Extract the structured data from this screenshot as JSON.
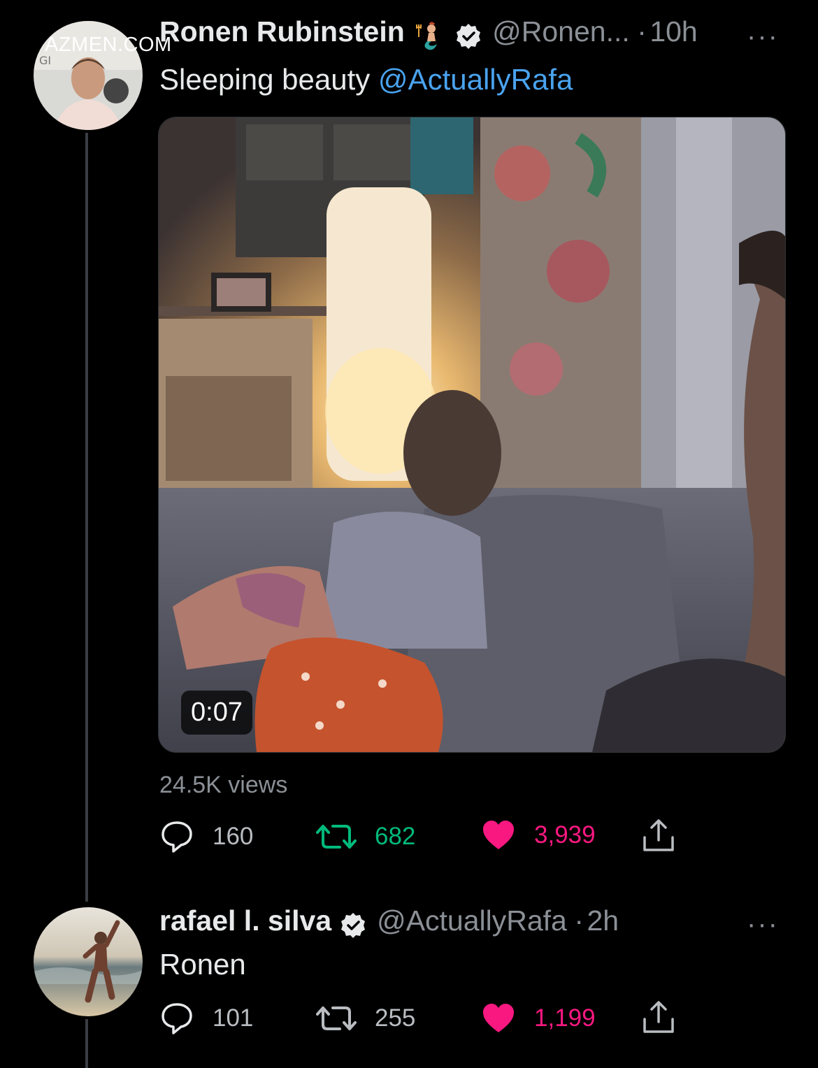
{
  "watermark": "AZMEN.COM",
  "tweet1": {
    "display_name": "Ronen Rubinstein",
    "emoji_icon": "merman-emoji-icon",
    "handle": "@Ronen...",
    "separator": "·",
    "time": "10h",
    "more": "···",
    "text_plain": "Sleeping beauty ",
    "mention": "@ActuallyRafa",
    "video": {
      "duration": "0:07"
    },
    "views": "24.5K views",
    "stats": {
      "replies": "160",
      "retweets": "682",
      "likes": "3,939"
    }
  },
  "tweet2": {
    "display_name": "rafael l. silva",
    "handle": "@ActuallyRafa",
    "separator": "·",
    "time": "2h",
    "more": "···",
    "text": "Ronen",
    "stats": {
      "replies": "101",
      "retweets": "255",
      "likes": "1,199"
    }
  },
  "colors": {
    "background": "#000000",
    "text": "#e7e9ea",
    "muted": "#8b9096",
    "mention": "#4aa3ef",
    "retweet_active": "#00ba7c",
    "like_active": "#f91880"
  }
}
